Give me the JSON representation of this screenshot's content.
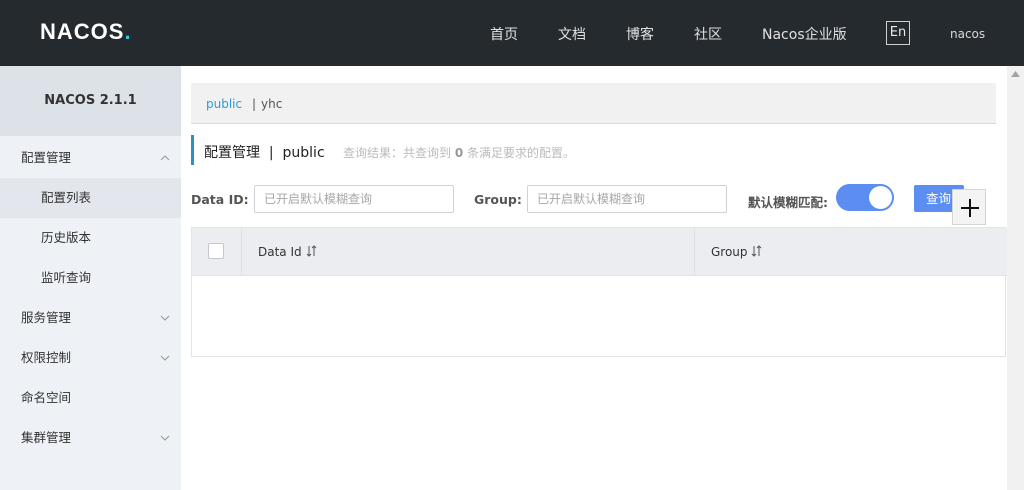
{
  "header": {
    "logo_text": "NACOS",
    "logo_dot": ".",
    "nav": [
      "首页",
      "文档",
      "博客",
      "社区",
      "Nacos企业版"
    ],
    "lang": "En",
    "user": "nacos"
  },
  "sidebar": {
    "title": "NACOS 2.1.1",
    "items": [
      {
        "label": "配置管理"
      },
      {
        "label": "配置列表"
      },
      {
        "label": "历史版本"
      },
      {
        "label": "监听查询"
      },
      {
        "label": "服务管理"
      },
      {
        "label": "权限控制"
      },
      {
        "label": "命名空间"
      },
      {
        "label": "集群管理"
      }
    ]
  },
  "namespace": {
    "public": "public",
    "separator": "|",
    "other": "yhc"
  },
  "page": {
    "title": "配置管理  |  public",
    "query_result_prefix": "查询结果：共查询到",
    "query_count": "0",
    "query_result_suffix": "条满足要求的配置。"
  },
  "search": {
    "dataid_label": "Data ID:",
    "dataid_placeholder": "已开启默认模糊查询",
    "group_label": "Group:",
    "group_placeholder": "已开启默认模糊查询",
    "fuzzy_label": "默认模糊匹配:",
    "fuzzy_enabled": true,
    "query_button": "查询"
  },
  "table": {
    "columns": [
      "Data Id",
      "Group"
    ],
    "rows": []
  },
  "colors": {
    "header_bg": "#252a2f",
    "accent": "#5b8ef0",
    "link": "#2f9bd6",
    "logo_dot": "#2fc9e8"
  }
}
